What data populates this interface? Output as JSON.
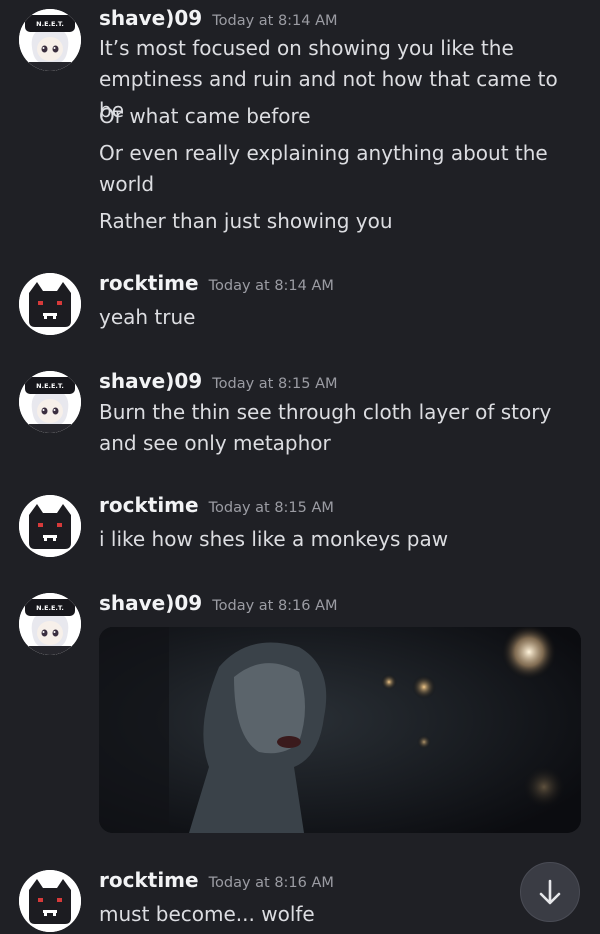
{
  "messages": [
    {
      "username": "shave)09",
      "timestamp": "Today at 8:14 AM",
      "lines": [
        "It’s most focused on showing you like the emptiness and ruin and not how that came to be",
        "Or what came before",
        "Or even really explaining anything about the world",
        "Rather than just showing you"
      ]
    },
    {
      "username": "rocktime",
      "timestamp": "Today at 8:14 AM",
      "lines": [
        "yeah true"
      ]
    },
    {
      "username": "shave)09",
      "timestamp": "Today at 8:15 AM",
      "lines": [
        "Burn the thin see through cloth layer of story and see only metaphor"
      ]
    },
    {
      "username": "rocktime",
      "timestamp": "Today at 8:15 AM",
      "lines": [
        "i like how shes like a monkeys paw"
      ]
    },
    {
      "username": "shave)09",
      "timestamp": "Today at 8:16 AM",
      "lines": []
    },
    {
      "username": "rocktime",
      "timestamp": "Today at 8:16 AM",
      "lines": [
        "must become... wolfe"
      ]
    }
  ],
  "avatars": {
    "shave": {
      "cap_text": "N.E.E.T."
    }
  },
  "icons": {
    "scroll_to_bottom": "arrow-down-icon"
  },
  "colors": {
    "background": "#1f2025",
    "username": "#f2f3f5",
    "timestamp": "#9b9ca3",
    "message_text": "#dcdde1",
    "scroll_button": "#3a3c44"
  }
}
